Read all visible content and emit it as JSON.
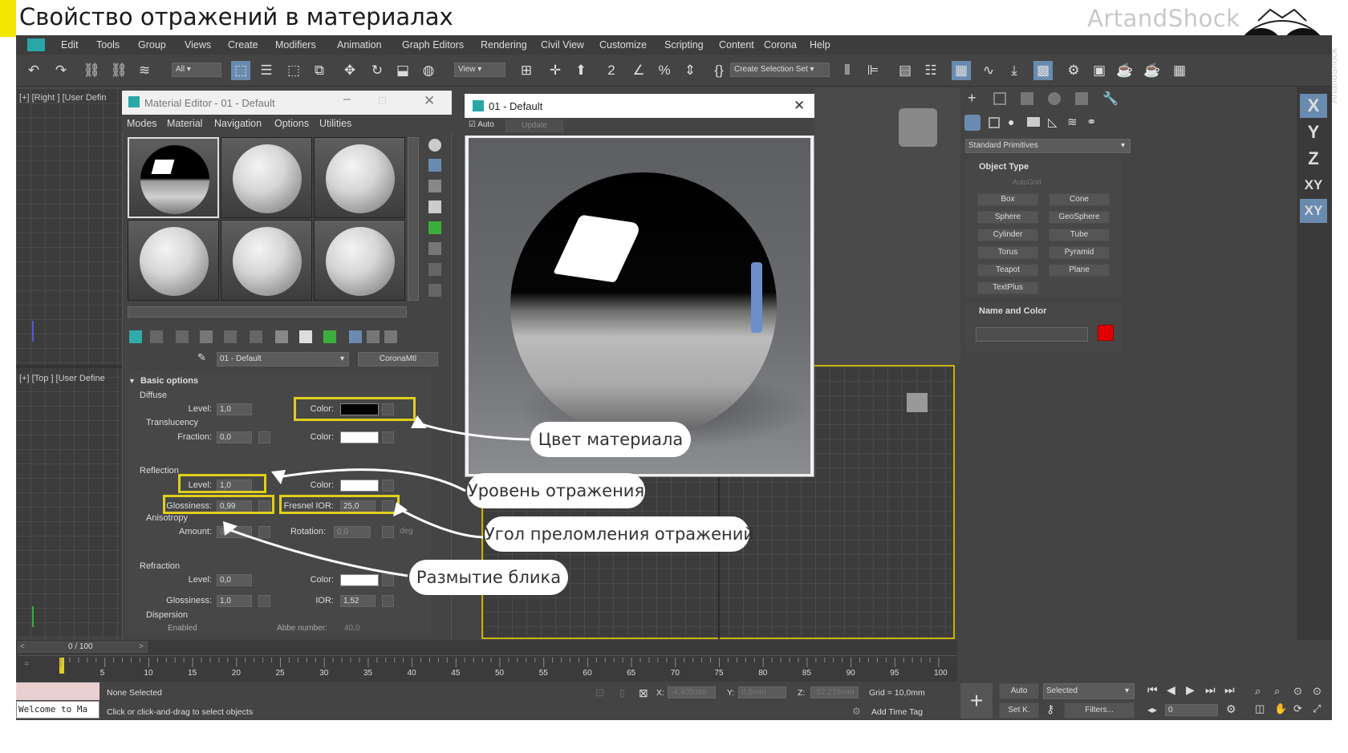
{
  "header": {
    "title": "Свойство отражений в материалах",
    "brand": "ArtandShock",
    "vertical_brand": "ArtandShock"
  },
  "menu": [
    "Edit",
    "Tools",
    "Group",
    "Views",
    "Create",
    "Modifiers",
    "Animation",
    "Graph Editors",
    "Rendering",
    "Civil View",
    "Customize",
    "Scripting",
    "Content",
    "Corona",
    "Help"
  ],
  "toolbar": {
    "filter": "All",
    "refcoord": "View",
    "selection_set": "Create Selection Set"
  },
  "viewports": {
    "top_left": "[+] [Right ] [User Defin",
    "bottom_left": "[+] [Top ] [User Define"
  },
  "material_editor": {
    "title": "Material Editor - 01 - Default",
    "menu": [
      "Modes",
      "Material",
      "Navigation",
      "Options",
      "Utilities"
    ],
    "material_name": "01 - Default",
    "material_type": "CoronaMtl",
    "section": "Basic options",
    "diffuse": {
      "heading": "Diffuse",
      "level_label": "Level:",
      "level": "1,0",
      "color_label": "Color:",
      "color": "#000000"
    },
    "translucency": {
      "heading": "Translucency",
      "fraction_label": "Fraction:",
      "fraction": "0,0",
      "color_label": "Color:",
      "color": "#ffffff"
    },
    "reflection": {
      "heading": "Reflection",
      "level_label": "Level:",
      "level": "1,0",
      "color_label": "Color:",
      "color": "#ffffff",
      "glossiness_label": "Glossiness:",
      "glossiness": "0,99",
      "fresnel_label": "Fresnel IOR:",
      "fresnel": "25,0"
    },
    "anisotropy": {
      "heading": "Anisotropy",
      "amount_label": "Amount:",
      "amount": "0,0",
      "rotation_label": "Rotation:",
      "rotation": "0,0",
      "rotation_unit": "deg"
    },
    "refraction": {
      "heading": "Refraction",
      "level_label": "Level:",
      "level": "0,0",
      "color_label": "Color:",
      "color": "#ffffff",
      "glossiness_label": "Glossiness:",
      "glossiness": "1,0",
      "ior_label": "IOR:",
      "ior": "1,52"
    },
    "dispersion": {
      "heading": "Dispersion",
      "enabled": "Enabled",
      "abbe_label": "Abbe number:",
      "abbe": "40,0"
    }
  },
  "render_window": {
    "title": "01 - Default",
    "auto": "Auto",
    "update": "Update"
  },
  "callouts": {
    "color": "Цвет материала",
    "level": "Уровень отражения",
    "ior": "Угол преломления отражений",
    "gloss": "Размытие блика"
  },
  "command_panel": {
    "category": "Standard Primitives",
    "object_type": "Object Type",
    "autogrid": "AutoGrid",
    "buttons": [
      "Box",
      "Cone",
      "Sphere",
      "GeoSphere",
      "Cylinder",
      "Tube",
      "Torus",
      "Pyramid",
      "Teapot",
      "Plane",
      "TextPlus"
    ],
    "name_color": "Name and Color",
    "object_color": "#e00000"
  },
  "axes": [
    "X",
    "Y",
    "Z",
    "XY",
    "XY"
  ],
  "timeline": {
    "frame": "0 / 100",
    "ticks": [
      "5",
      "10",
      "15",
      "20",
      "25",
      "30",
      "35",
      "40",
      "45",
      "50",
      "55",
      "60",
      "65",
      "70",
      "75",
      "80",
      "85",
      "90",
      "95",
      "100"
    ]
  },
  "status": {
    "welcome": "Welcome to Ma",
    "none_selected": "None Selected",
    "hint": "Click or click-and-drag to select objects",
    "x_label": "X:",
    "x": "-4,405mm",
    "y_label": "Y:",
    "y": "0,0mm",
    "z_label": "Z:",
    "z": "-52,276mm",
    "grid": "Grid = 10,0mm",
    "add_time_tag": "Add Time Tag",
    "auto": "Auto",
    "selected": "Selected",
    "setkey": "Set K.",
    "filters": "Filters...",
    "frame": "0"
  }
}
